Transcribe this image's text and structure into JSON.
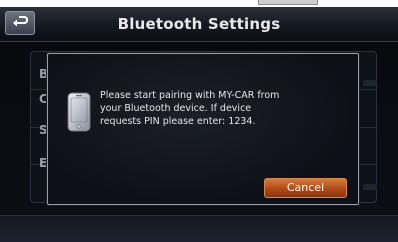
{
  "header": {
    "title": "Bluetooth Settings",
    "back_icon": "return-arrow-icon"
  },
  "list": {
    "letters": [
      "B",
      "C",
      "S",
      "E"
    ]
  },
  "dialog": {
    "icon": "smartphone-icon",
    "message": "Please start pairing with MY-CAR from\nyour Bluetooth device.  If device\nrequests PIN please enter: 1234.",
    "cancel_label": "Cancel"
  },
  "colors": {
    "accent": "#c55e22",
    "background": "#0a0d12"
  }
}
